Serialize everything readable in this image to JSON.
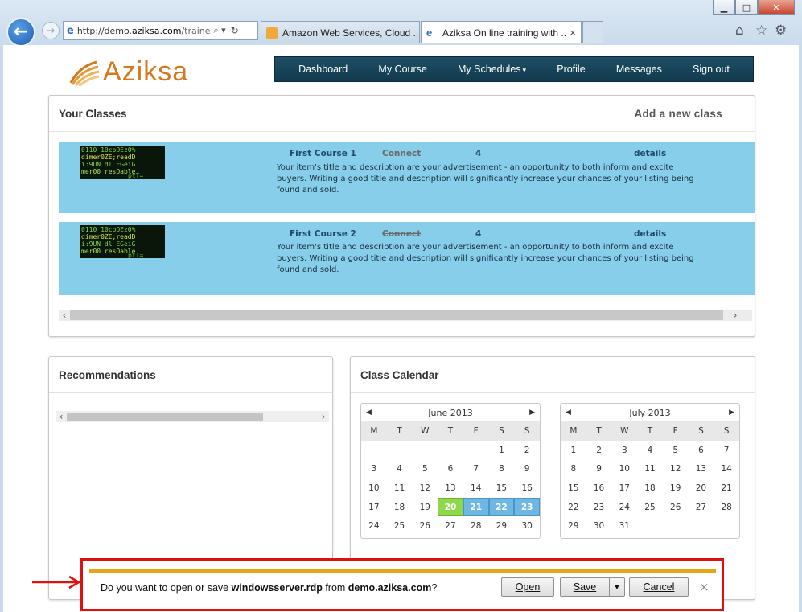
{
  "browser": {
    "window_controls": {
      "minimize": "▁",
      "maximize": "□",
      "close": "✕"
    },
    "address": {
      "prefix": "http://demo.",
      "domain": "aziksa.com",
      "suffix": "/traine",
      "search_glyph": "⌕ ▾",
      "refresh_glyph": "↻"
    },
    "tabs": [
      {
        "label": "Amazon Web Services, Cloud ..."
      },
      {
        "label": "Aziksa On line training with ...",
        "close": "×"
      }
    ],
    "toolbar_icons": {
      "home": "⌂",
      "favorites": "☆",
      "tools": "⚙"
    }
  },
  "site": {
    "logo_text": "Aziksa",
    "nav": [
      "Dashboard",
      "My Course",
      "My Schedules",
      "Profile",
      "Messages",
      "Sign out"
    ],
    "dropdown_caret": "▾"
  },
  "classes": {
    "title": "Your Classes",
    "add_label": "Add a new class",
    "items": [
      {
        "title": "First Course 1",
        "action": "Connect",
        "count": "4",
        "details": "details",
        "description": "Your item's title and description are your advertisement - an opportunity to both inform and excite buyers. Writing a good title and description will significantly increase your chances of your listing being found and sold.",
        "action_struck": false
      },
      {
        "title": "First Course 2",
        "action": "Connect",
        "count": "4",
        "details": "details",
        "description": "Your item's title and description are your advertisement - an opportunity to both inform and excite buyers. Writing a good title and description will significantly increase your chances of your listing being found and sold.",
        "action_struck": true
      }
    ]
  },
  "recommendations": {
    "title": "Recommendations"
  },
  "calendar": {
    "title": "Class Calendar",
    "weekdays": [
      "M",
      "T",
      "W",
      "T",
      "F",
      "S",
      "S"
    ],
    "months": [
      {
        "name": "June 2013",
        "offset": 5,
        "days": 30,
        "highlight_green": [
          20
        ],
        "highlight_blue": [
          21,
          22,
          23
        ]
      },
      {
        "name": "July 2013",
        "offset": 0,
        "days": 31,
        "highlight_green": [],
        "highlight_blue": []
      }
    ],
    "prev": "◀",
    "next": "▶"
  },
  "download_bar": {
    "prompt_before": "Do you want to open or save ",
    "filename": "windowsserver.rdp",
    "prompt_middle": " from ",
    "source": "demo.aziksa.com",
    "prompt_after": "?",
    "open": "Open",
    "save": "Save",
    "cancel": "Cancel",
    "close": "×",
    "dropdown": "▼"
  },
  "colors": {
    "nav_bg": "#1a4a60",
    "row_bg": "#87ceeb",
    "green": "#8fd84b",
    "blue": "#6fb7e3",
    "annotation": "#e01010"
  }
}
